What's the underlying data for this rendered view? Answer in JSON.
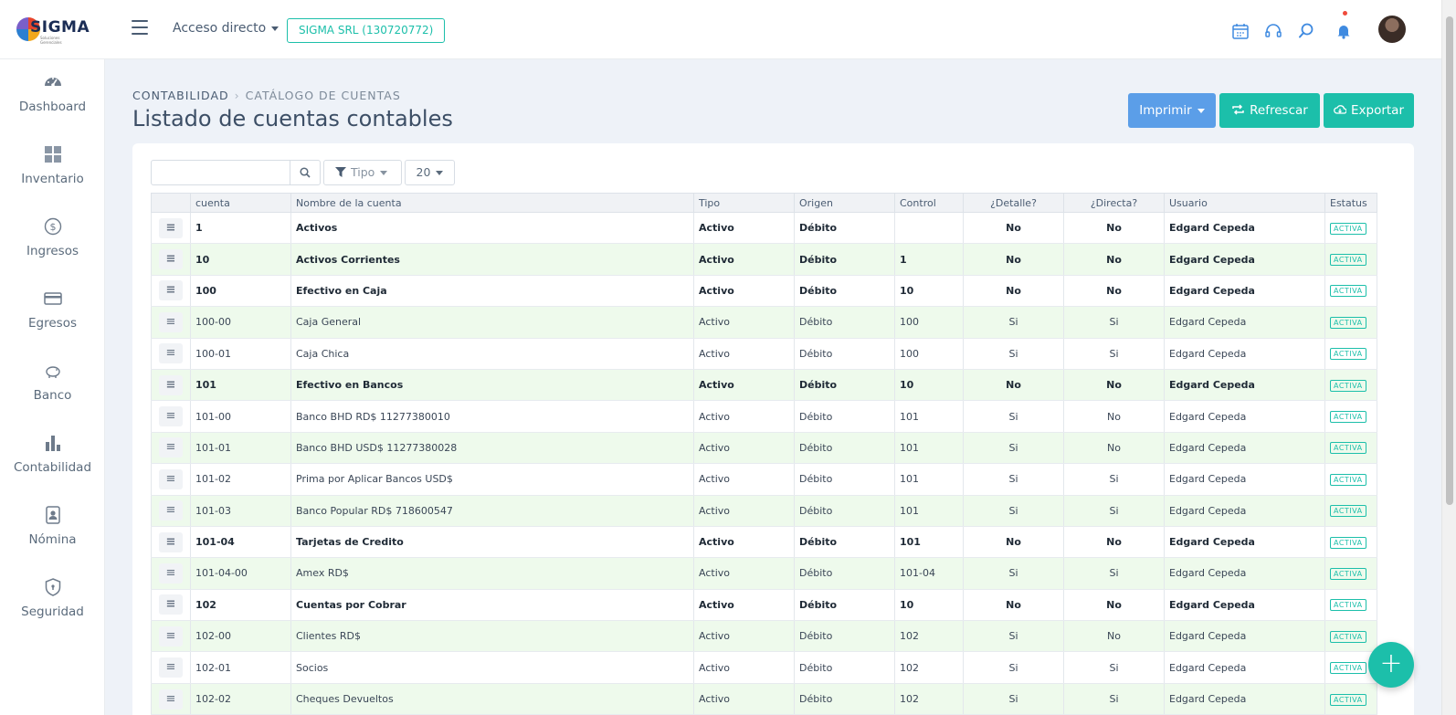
{
  "header": {
    "logo_text": "SIGMA",
    "logo_subtext": "Soluciones Gerenciales",
    "acceso_label": "Acceso directo",
    "company_label": "SIGMA SRL (130720772)",
    "icons": [
      "calendar-icon",
      "headset-icon",
      "search-icon",
      "bell-icon"
    ]
  },
  "sidebar": {
    "items": [
      {
        "label": "Dashboard",
        "icon": "gauge-icon"
      },
      {
        "label": "Inventario",
        "icon": "grid-icon"
      },
      {
        "label": "Ingresos",
        "icon": "dollar-circle-icon"
      },
      {
        "label": "Egresos",
        "icon": "credit-card-icon"
      },
      {
        "label": "Banco",
        "icon": "piggy-bank-icon"
      },
      {
        "label": "Contabilidad",
        "icon": "bar-chart-icon"
      },
      {
        "label": "Nómina",
        "icon": "id-badge-icon"
      },
      {
        "label": "Seguridad",
        "icon": "shield-icon"
      }
    ]
  },
  "breadcrumb": {
    "root": "CONTABILIDAD",
    "current": "CATÁLOGO DE CUENTAS"
  },
  "page_title": "Listado de cuentas contables",
  "actions": {
    "print": "Imprimir",
    "refresh": "Refrescar",
    "export": "Exportar"
  },
  "filters": {
    "search_value": "",
    "tipo_label": "Tipo",
    "page_size": "20"
  },
  "table": {
    "columns": [
      "cuenta",
      "Nombre de la cuenta",
      "Tipo",
      "Origen",
      "Control",
      "¿Detalle?",
      "¿Directa?",
      "Usuario",
      "Estatus"
    ],
    "rows": [
      {
        "cuenta": "1",
        "nombre": "Activos",
        "tipo": "Activo",
        "origen": "Débito",
        "control": "",
        "detalle": "No",
        "directa": "No",
        "usuario": "Edgard Cepeda",
        "estatus": "ACTIVA",
        "bold": true
      },
      {
        "cuenta": "10",
        "nombre": "Activos Corrientes",
        "tipo": "Activo",
        "origen": "Débito",
        "control": "1",
        "detalle": "No",
        "directa": "No",
        "usuario": "Edgard Cepeda",
        "estatus": "ACTIVA",
        "bold": true
      },
      {
        "cuenta": "100",
        "nombre": "Efectivo en Caja",
        "tipo": "Activo",
        "origen": "Débito",
        "control": "10",
        "detalle": "No",
        "directa": "No",
        "usuario": "Edgard Cepeda",
        "estatus": "ACTIVA",
        "bold": true
      },
      {
        "cuenta": "100-00",
        "nombre": "Caja General",
        "tipo": "Activo",
        "origen": "Débito",
        "control": "100",
        "detalle": "Si",
        "directa": "Si",
        "usuario": "Edgard Cepeda",
        "estatus": "ACTIVA",
        "bold": false
      },
      {
        "cuenta": "100-01",
        "nombre": "Caja Chica",
        "tipo": "Activo",
        "origen": "Débito",
        "control": "100",
        "detalle": "Si",
        "directa": "Si",
        "usuario": "Edgard Cepeda",
        "estatus": "ACTIVA",
        "bold": false
      },
      {
        "cuenta": "101",
        "nombre": "Efectivo en Bancos",
        "tipo": "Activo",
        "origen": "Débito",
        "control": "10",
        "detalle": "No",
        "directa": "No",
        "usuario": "Edgard Cepeda",
        "estatus": "ACTIVA",
        "bold": true
      },
      {
        "cuenta": "101-00",
        "nombre": "Banco BHD RD$ 11277380010",
        "tipo": "Activo",
        "origen": "Débito",
        "control": "101",
        "detalle": "Si",
        "directa": "No",
        "usuario": "Edgard Cepeda",
        "estatus": "ACTIVA",
        "bold": false
      },
      {
        "cuenta": "101-01",
        "nombre": "Banco BHD USD$ 11277380028",
        "tipo": "Activo",
        "origen": "Débito",
        "control": "101",
        "detalle": "Si",
        "directa": "No",
        "usuario": "Edgard Cepeda",
        "estatus": "ACTIVA",
        "bold": false
      },
      {
        "cuenta": "101-02",
        "nombre": "Prima por Aplicar Bancos USD$",
        "tipo": "Activo",
        "origen": "Débito",
        "control": "101",
        "detalle": "Si",
        "directa": "Si",
        "usuario": "Edgard Cepeda",
        "estatus": "ACTIVA",
        "bold": false
      },
      {
        "cuenta": "101-03",
        "nombre": "Banco Popular RD$ 718600547",
        "tipo": "Activo",
        "origen": "Débito",
        "control": "101",
        "detalle": "Si",
        "directa": "Si",
        "usuario": "Edgard Cepeda",
        "estatus": "ACTIVA",
        "bold": false
      },
      {
        "cuenta": "101-04",
        "nombre": "Tarjetas de Credito",
        "tipo": "Activo",
        "origen": "Débito",
        "control": "101",
        "detalle": "No",
        "directa": "No",
        "usuario": "Edgard Cepeda",
        "estatus": "ACTIVA",
        "bold": true
      },
      {
        "cuenta": "101-04-00",
        "nombre": "Amex RD$",
        "tipo": "Activo",
        "origen": "Débito",
        "control": "101-04",
        "detalle": "Si",
        "directa": "Si",
        "usuario": "Edgard Cepeda",
        "estatus": "ACTIVA",
        "bold": false
      },
      {
        "cuenta": "102",
        "nombre": "Cuentas por Cobrar",
        "tipo": "Activo",
        "origen": "Débito",
        "control": "10",
        "detalle": "No",
        "directa": "No",
        "usuario": "Edgard Cepeda",
        "estatus": "ACTIVA",
        "bold": true
      },
      {
        "cuenta": "102-00",
        "nombre": "Clientes RD$",
        "tipo": "Activo",
        "origen": "Débito",
        "control": "102",
        "detalle": "Si",
        "directa": "No",
        "usuario": "Edgard Cepeda",
        "estatus": "ACTIVA",
        "bold": false
      },
      {
        "cuenta": "102-01",
        "nombre": "Socios",
        "tipo": "Activo",
        "origen": "Débito",
        "control": "102",
        "detalle": "Si",
        "directa": "Si",
        "usuario": "Edgard Cepeda",
        "estatus": "ACTIVA",
        "bold": false
      },
      {
        "cuenta": "102-02",
        "nombre": "Cheques Devueltos",
        "tipo": "Activo",
        "origen": "Débito",
        "control": "102",
        "detalle": "Si",
        "directa": "Si",
        "usuario": "Edgard Cepeda",
        "estatus": "ACTIVA",
        "bold": false
      }
    ]
  },
  "fab": {
    "icon": "plus-icon"
  },
  "colors": {
    "accent": "#1cbfaa",
    "primary": "#5b9ee8",
    "row_alt": "#eefaec",
    "background": "#eef2f8"
  }
}
